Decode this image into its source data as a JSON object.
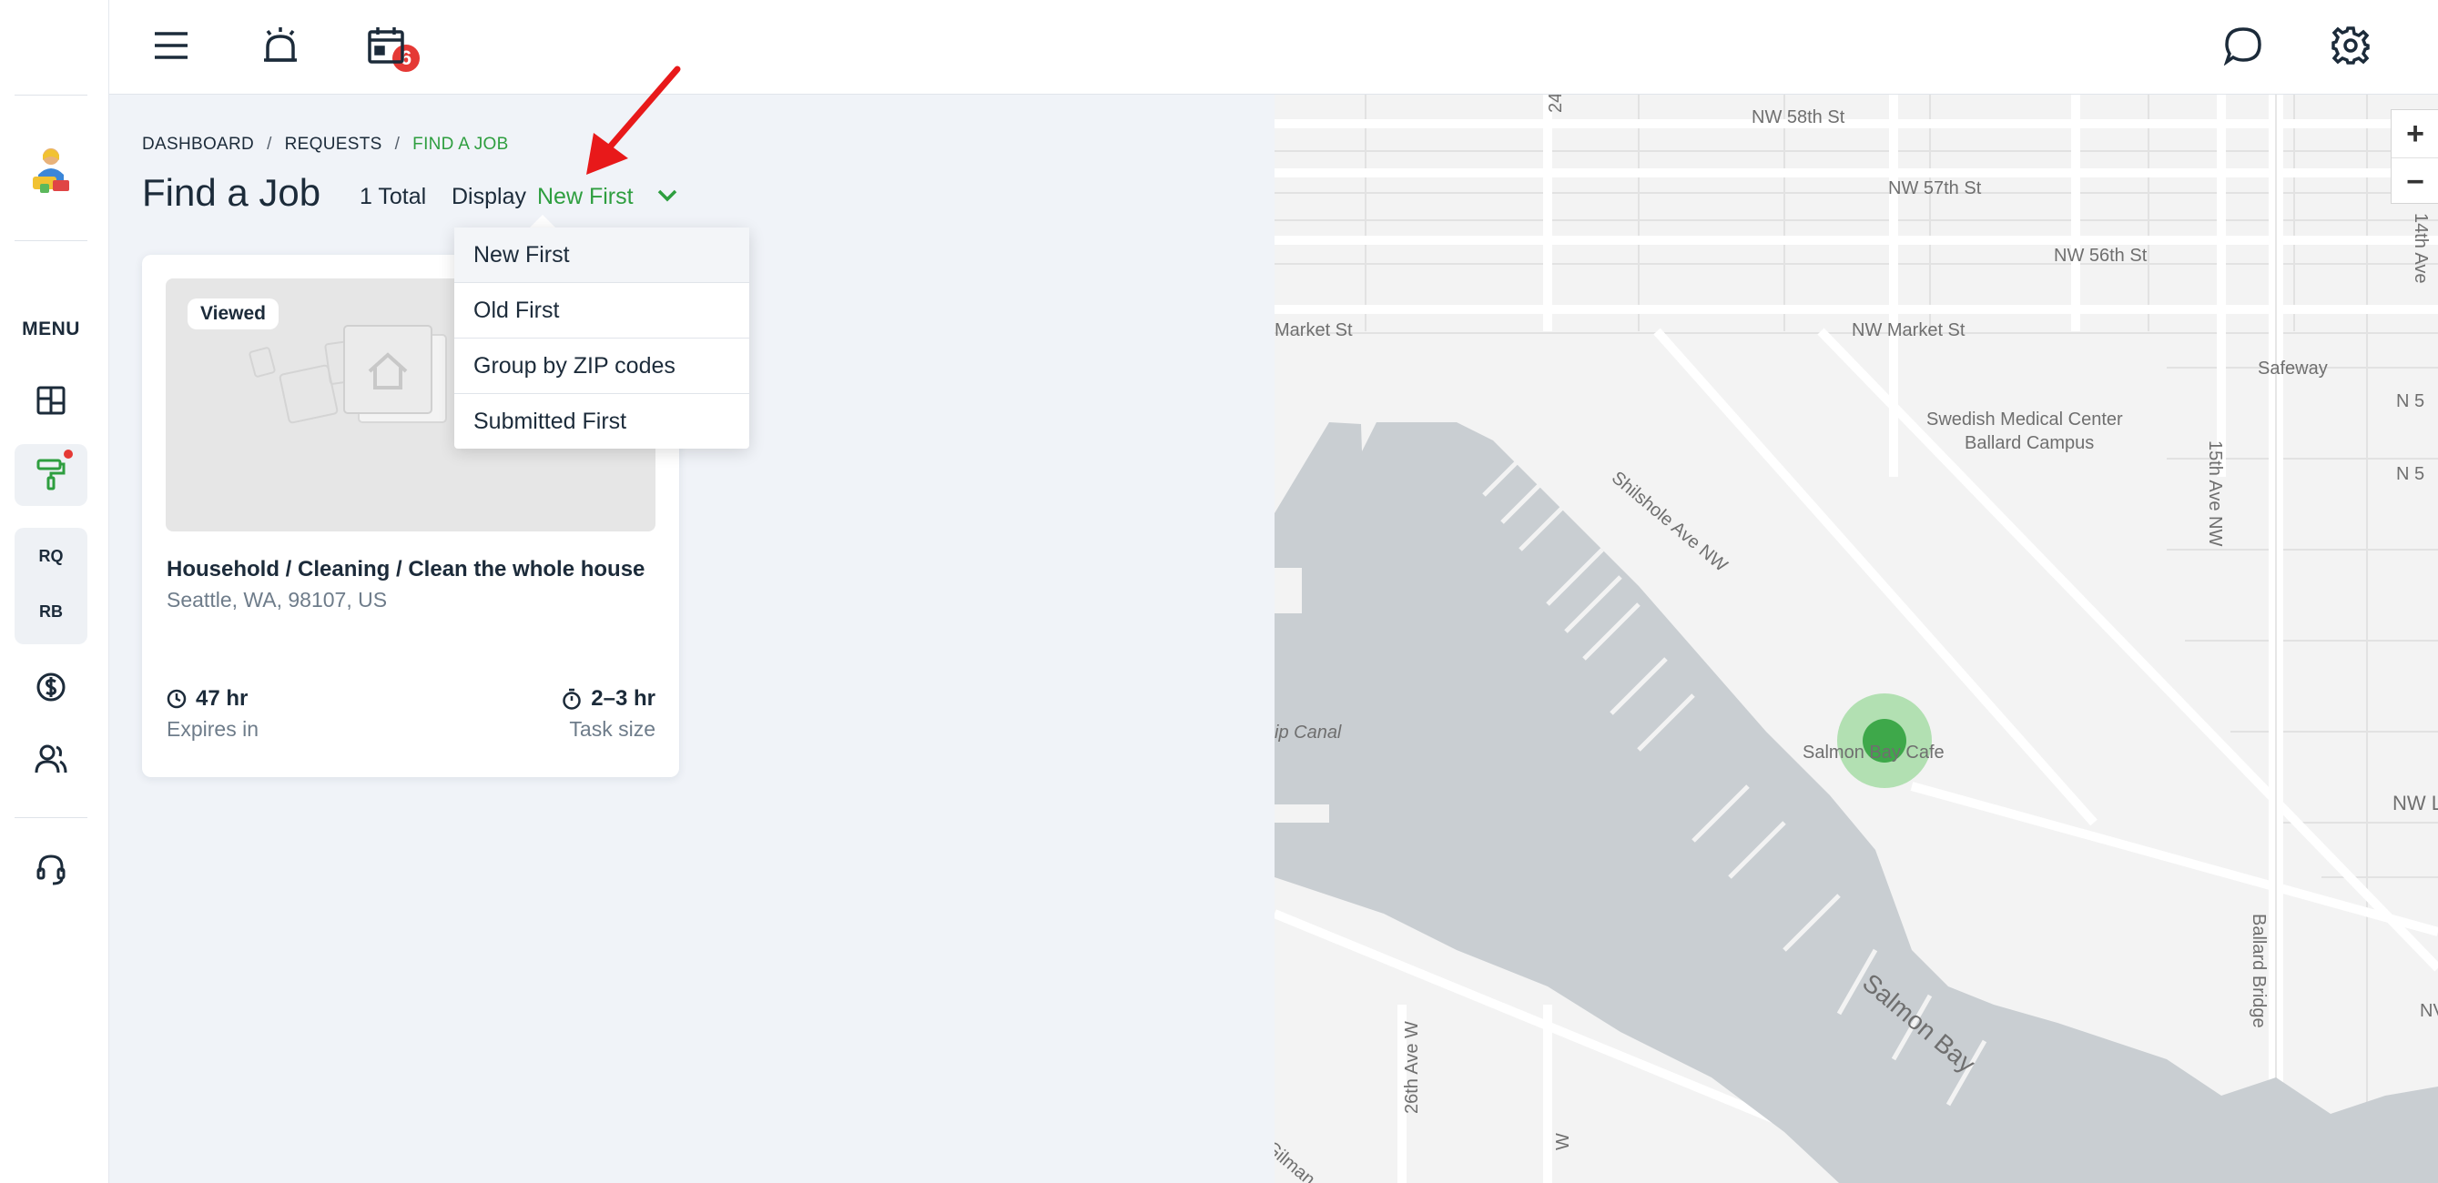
{
  "sidebar": {
    "menu_label": "MENU",
    "abbr_1": "RQ",
    "abbr_2": "RB"
  },
  "topbar": {
    "notifications_count": "6"
  },
  "breadcrumb": {
    "items": [
      "DASHBOARD",
      "REQUESTS",
      "FIND A JOB"
    ]
  },
  "page": {
    "title": "Find a Job",
    "total": "1 Total",
    "display_label": "Display",
    "display_value": "New First"
  },
  "dropdown": {
    "options": [
      "New First",
      "Old First",
      "Group by ZIP codes",
      "Submitted First"
    ]
  },
  "job": {
    "badge": "Viewed",
    "title": "Household / Cleaning / Clean the whole house",
    "location": "Seattle, WA, 98107, US",
    "expires_value": "47 hr",
    "expires_label": "Expires in",
    "task_value": "2–3 hr",
    "task_label": "Task size"
  },
  "map": {
    "labels": {
      "nw58": "NW 58th St",
      "nw57": "NW 57th St",
      "nw56": "NW 56th St",
      "market_left": "Market St",
      "market": "NW Market St",
      "safeway": "Safeway",
      "swedish_1": "Swedish Medical Center",
      "swedish_2": "Ballard Campus",
      "ave15": "15th Ave NW",
      "shilshole": "Shilshole Ave NW",
      "canal": "ip Canal",
      "salmon_cafe": "Salmon Bay Cafe",
      "salmon_bay": "Salmon Bay",
      "ave26": "26th Ave W",
      "ballard_bridge": "Ballard Bridge",
      "nwl": "NW L",
      "nw_right": "NV",
      "ave14": "14th Ave",
      "gilman": "Gilman",
      "n5a": "N 5",
      "n5b": "N 5",
      "w_ave": "W",
      "ave24": "24"
    },
    "zoom_in": "+",
    "zoom_out": "−"
  },
  "colors": {
    "accent": "#2e9e3f",
    "badge": "#e53935",
    "water": "#c9ced2"
  }
}
